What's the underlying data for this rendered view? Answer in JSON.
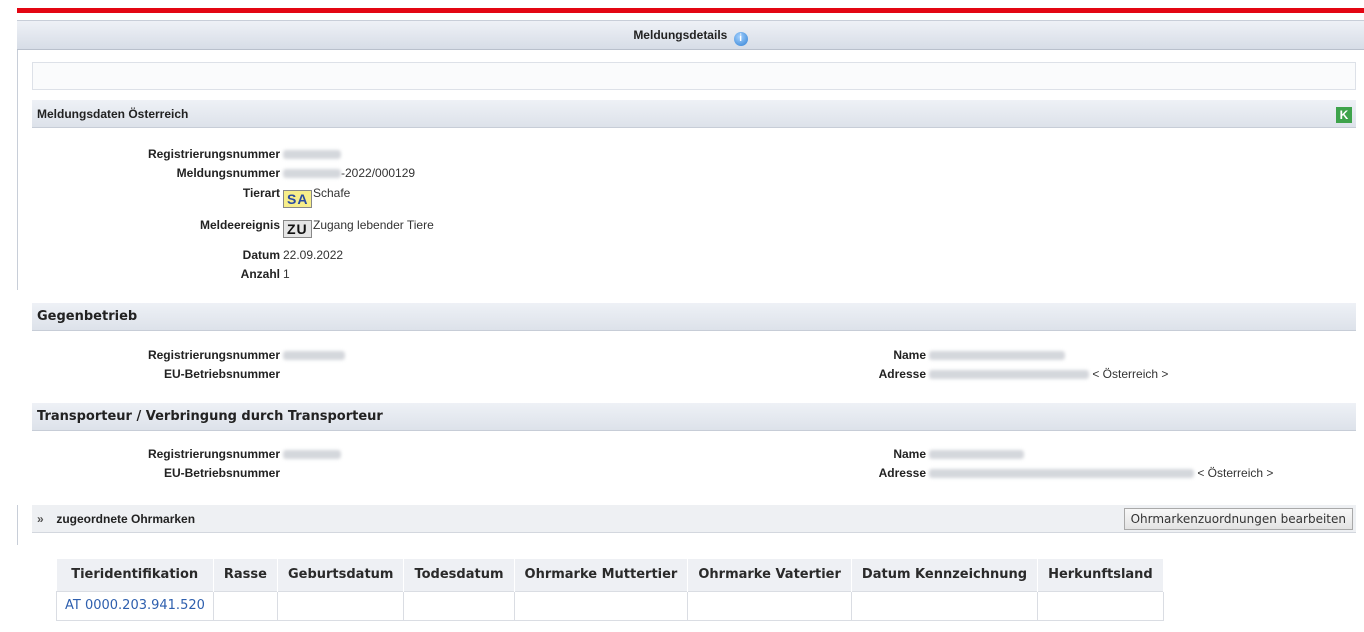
{
  "header": {
    "title": "Meldungsdetails",
    "info_icon": "i"
  },
  "meldungsdaten": {
    "title": "Meldungsdaten Österreich",
    "k_icon": "K",
    "reg_label": "Registrierungsnummer",
    "meld_label": "Meldungsnummer",
    "meld_suffix": "-2022/000129",
    "tierart_label": "Tierart",
    "tierart_code": "SA",
    "tierart_value": "Schafe",
    "ereignis_label": "Meldeereignis",
    "ereignis_code": "ZU",
    "ereignis_value": "Zugang lebender Tiere",
    "datum_label": "Datum",
    "datum_value": "22.09.2022",
    "anzahl_label": "Anzahl",
    "anzahl_value": "1"
  },
  "gegenbetrieb": {
    "title": "Gegenbetrieb",
    "reg_label": "Registrierungsnummer",
    "eu_label": "EU-Betriebsnummer",
    "name_label": "Name",
    "adresse_label": "Adresse",
    "country": "< Österreich >"
  },
  "transporteur": {
    "title": "Transporteur / Verbringung durch Transporteur",
    "reg_label": "Registrierungsnummer",
    "eu_label": "EU-Betriebsnummer",
    "name_label": "Name",
    "adresse_label": "Adresse",
    "country": "< Österreich >"
  },
  "ohrmarken": {
    "title": "zugeordnete Ohrmarken",
    "edit_button": "Ohrmarkenzuordnungen bearbeiten",
    "columns": [
      "Tieridentifikation",
      "Rasse",
      "Geburtsdatum",
      "Todesdatum",
      "Ohrmarke Muttertier",
      "Ohrmarke Vatertier",
      "Datum Kennzeichnung",
      "Herkunftsland"
    ],
    "rows": [
      {
        "tieridentifikation": "AT 0000.203.941.520"
      }
    ]
  }
}
